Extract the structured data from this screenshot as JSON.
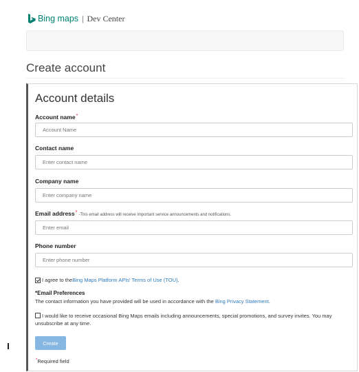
{
  "brand": {
    "name": "Bing maps",
    "separator": "|",
    "subtitle": "Dev Center",
    "color": "#008272"
  },
  "page": {
    "title": "Create account"
  },
  "form": {
    "section_title": "Account details",
    "required_marker": "*",
    "fields": {
      "account_name": {
        "label": "Account name",
        "placeholder": "Account Name",
        "value": "",
        "required": true
      },
      "contact_name": {
        "label": "Contact name",
        "placeholder": "Enter contact name",
        "value": ""
      },
      "company_name": {
        "label": "Company name",
        "placeholder": "Enter company name",
        "value": ""
      },
      "email": {
        "label": "Email address",
        "placeholder": "Enter email",
        "value": "",
        "required": true,
        "note": "-This email address will receive important service announcements and notifications."
      },
      "phone": {
        "label": "Phone number",
        "placeholder": "Enter phone number",
        "value": ""
      }
    },
    "terms": {
      "checked": true,
      "prefix": "I agree to the ",
      "link_text": "Bing Maps Platform APIs' Terms of Use (TOU)",
      "suffix": "."
    },
    "email_prefs": {
      "title": "*Email Preferences",
      "text": "The contact information you have provided will be used in accordance with the ",
      "link_text": "Bing Privacy Statement",
      "suffix": "."
    },
    "optin": {
      "checked": false,
      "text": "I would like to receive occasional Bing Maps emails including announcements, special promotions, and survey invites. You may unsubscribe at any time."
    },
    "create_label": "Create",
    "required_note": "Required field"
  },
  "colors": {
    "link": "#2f7bbf",
    "required": "#e81123",
    "button": "#86b7e2",
    "panel_accent": "#555555"
  },
  "icons": {
    "logo": "bing-b-logo-icon",
    "check": "checkbox-icon"
  }
}
